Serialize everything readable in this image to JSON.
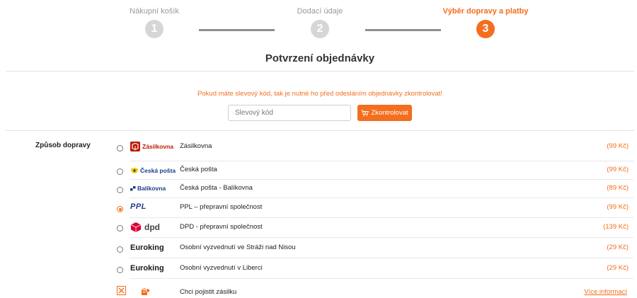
{
  "steps": [
    {
      "label": "Nákupní košík",
      "number": "1"
    },
    {
      "label": "Dodací údaje",
      "number": "2"
    },
    {
      "label": "Výběr dopravy a platby",
      "number": "3"
    }
  ],
  "title": "Potvrzení objednávky",
  "discount": {
    "note": "Pokud máte slevový kód, tak je nutné ho před odesláním objednávky zkontrolovat!",
    "placeholder": "Slevový kód",
    "button_label": "Zkontrolovat"
  },
  "shipping": {
    "section_label": "Způsob dopravy",
    "options": [
      {
        "logo": "Zásilkovna",
        "name": "Zásilkovna",
        "price": "(99 Kč)",
        "selected": false
      },
      {
        "logo": "Česká pošta",
        "name": "Česká pošta",
        "price": "(99 Kč)",
        "selected": false
      },
      {
        "logo": "Balíkovna",
        "name": "Česká pošta - Balíkovna",
        "price": "(89 Kč)",
        "selected": false
      },
      {
        "logo": "PPL",
        "name": "PPL – přepravní společnost",
        "price": "(99 Kč)",
        "selected": true
      },
      {
        "logo": "dpd",
        "name": "DPD - přepravní společnost",
        "price": "(139 Kč)",
        "selected": false
      },
      {
        "logo": "Euroking",
        "name": "Osobní vyzvednutí ve Stráži nad Nisou",
        "price": "(29 Kč)",
        "selected": false
      },
      {
        "logo": "Euroking",
        "name": "Osobní vyzvednutí v Liberci",
        "price": "(29 Kč)",
        "selected": false
      }
    ]
  },
  "insurance": {
    "label": "Chci pojistit zásilku",
    "link": "Více informací",
    "checked": true
  },
  "colors": {
    "accent": "#f36e1e",
    "inactive_step": "#d6d6d6"
  }
}
